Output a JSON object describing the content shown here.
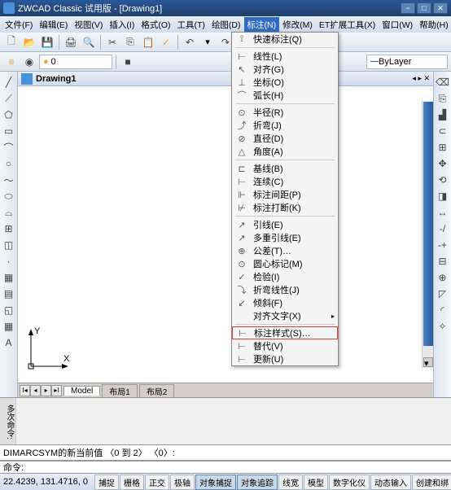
{
  "title": "ZWCAD Classic 试用版 - [Drawing1]",
  "menus": [
    "文件(F)",
    "编辑(E)",
    "视图(V)",
    "插入(I)",
    "格式(O)",
    "工具(T)",
    "绘图(D)",
    "标注(N)",
    "修改(M)",
    "ET扩展工具(X)",
    "窗口(W)",
    "帮助(H)"
  ],
  "activeMenu": 7,
  "docTitle": "Drawing1",
  "layerCombo": "0",
  "bylayerCombo": "ByLayer",
  "dropdown": [
    {
      "icon": "⟟",
      "label": "快速标注(Q)",
      "sep": true
    },
    {
      "icon": "⊢",
      "label": "线性(L)"
    },
    {
      "icon": "↖",
      "label": "对齐(G)"
    },
    {
      "icon": "⊥",
      "label": "坐标(O)"
    },
    {
      "icon": "⌒",
      "label": "弧长(H)",
      "sep": true
    },
    {
      "icon": "⊙",
      "label": "半径(R)"
    },
    {
      "icon": "⤴",
      "label": "折弯(J)"
    },
    {
      "icon": "⊘",
      "label": "直径(D)"
    },
    {
      "icon": "△",
      "label": "角度(A)",
      "sep": true
    },
    {
      "icon": "⊏",
      "label": "基线(B)"
    },
    {
      "icon": "⊢",
      "label": "连续(C)"
    },
    {
      "icon": "⊩",
      "label": "标注间距(P)"
    },
    {
      "icon": "⊬",
      "label": "标注打断(K)",
      "sep": true
    },
    {
      "icon": "↗",
      "label": "引线(E)"
    },
    {
      "icon": "↗",
      "label": "多重引线(E)"
    },
    {
      "icon": "⊕",
      "label": "公差(T)…"
    },
    {
      "icon": "⊙",
      "label": "圆心标记(M)"
    },
    {
      "icon": "✓",
      "label": "检验(I)"
    },
    {
      "icon": "⤵",
      "label": "折弯线性(J)"
    },
    {
      "icon": "↙",
      "label": "倾斜(F)"
    },
    {
      "icon": " ",
      "label": "对齐文字(X)",
      "sub": "▸",
      "sep": true
    },
    {
      "icon": "⊢",
      "label": "标注样式(S)…",
      "hl": true
    },
    {
      "icon": "⊢",
      "label": "替代(V)"
    },
    {
      "icon": "⊢",
      "label": "更新(U)"
    }
  ],
  "tabs": {
    "model": "Model",
    "l1": "布局1",
    "l2": "布局2"
  },
  "cmd": {
    "mark": "多次命令:",
    "text": "DIMARCSYM的新当前值 〈0 到 2〉 〈0〉:",
    "prompt": "命令:"
  },
  "status": {
    "coord": "22.4239, 131.4716, 0",
    "buttons": [
      "捕捉",
      "栅格",
      "正交",
      "极轴",
      "对象捕捉",
      "对象追踪",
      "线宽",
      "模型",
      "数字化仪",
      "动态输入",
      "创建和绑"
    ]
  },
  "ucs": {
    "y": "Y",
    "x": "X"
  },
  "docClose": "✕"
}
